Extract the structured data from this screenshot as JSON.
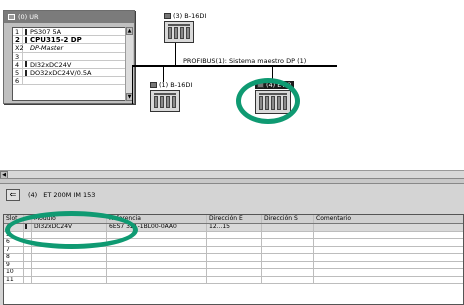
{
  "rack": {
    "title": "(0) UR",
    "slots": [
      {
        "no": "1",
        "module": "PS307 5A",
        "style": "normal",
        "mark": true
      },
      {
        "no": "2",
        "module": "CPU315-2 DP",
        "style": "bold",
        "mark": true
      },
      {
        "no": "X2",
        "module": "DP-Master",
        "style": "italic",
        "mark": false
      },
      {
        "no": "3",
        "module": "",
        "style": "normal",
        "mark": false
      },
      {
        "no": "4",
        "module": "DI32xDC24V",
        "style": "normal",
        "mark": true
      },
      {
        "no": "5",
        "module": "DO32xDC24V/0.5A",
        "style": "normal",
        "mark": true
      },
      {
        "no": "6",
        "module": "",
        "style": "normal",
        "mark": false
      }
    ]
  },
  "bus": {
    "label": "PROFIBUS(1): Sistema maestro DP (1)"
  },
  "nodes": {
    "node3": "(3) B-16DI",
    "node1": "(1) B-16DI",
    "node4": "(4) ET 2"
  },
  "station": {
    "slot_ref": "(4)",
    "title": "ET 200M IM 153",
    "columns": [
      "Slot",
      "",
      "Módulo",
      "Referencia",
      "Dirección E",
      "Dirección S",
      "Comentario"
    ],
    "rows": [
      {
        "slot": "4",
        "mark": true,
        "module": "DI32xDC24V",
        "ref": "6ES7 321-1BL00-0AA0",
        "addr_e": "12...15",
        "addr_s": "",
        "comment": ""
      },
      {
        "slot": "5",
        "mark": false,
        "module": "",
        "ref": "",
        "addr_e": "",
        "addr_s": "",
        "comment": ""
      },
      {
        "slot": "6",
        "mark": false,
        "module": "",
        "ref": "",
        "addr_e": "",
        "addr_s": "",
        "comment": ""
      },
      {
        "slot": "7",
        "mark": false,
        "module": "",
        "ref": "",
        "addr_e": "",
        "addr_s": "",
        "comment": ""
      },
      {
        "slot": "8",
        "mark": false,
        "module": "",
        "ref": "",
        "addr_e": "",
        "addr_s": "",
        "comment": ""
      },
      {
        "slot": "9",
        "mark": false,
        "module": "",
        "ref": "",
        "addr_e": "",
        "addr_s": "",
        "comment": ""
      },
      {
        "slot": "10",
        "mark": false,
        "module": "",
        "ref": "",
        "addr_e": "",
        "addr_s": "",
        "comment": ""
      },
      {
        "slot": "11",
        "mark": false,
        "module": "",
        "ref": "",
        "addr_e": "",
        "addr_s": "",
        "comment": ""
      }
    ]
  },
  "icons": {
    "back": "left-arrow-icon",
    "device": "io-module-icon",
    "rack": "rack-icon"
  },
  "colors": {
    "highlight_ring": "#0f9a72",
    "selected_label_bg": "#1c1c1c",
    "panel_bg": "#d4d4d4"
  }
}
